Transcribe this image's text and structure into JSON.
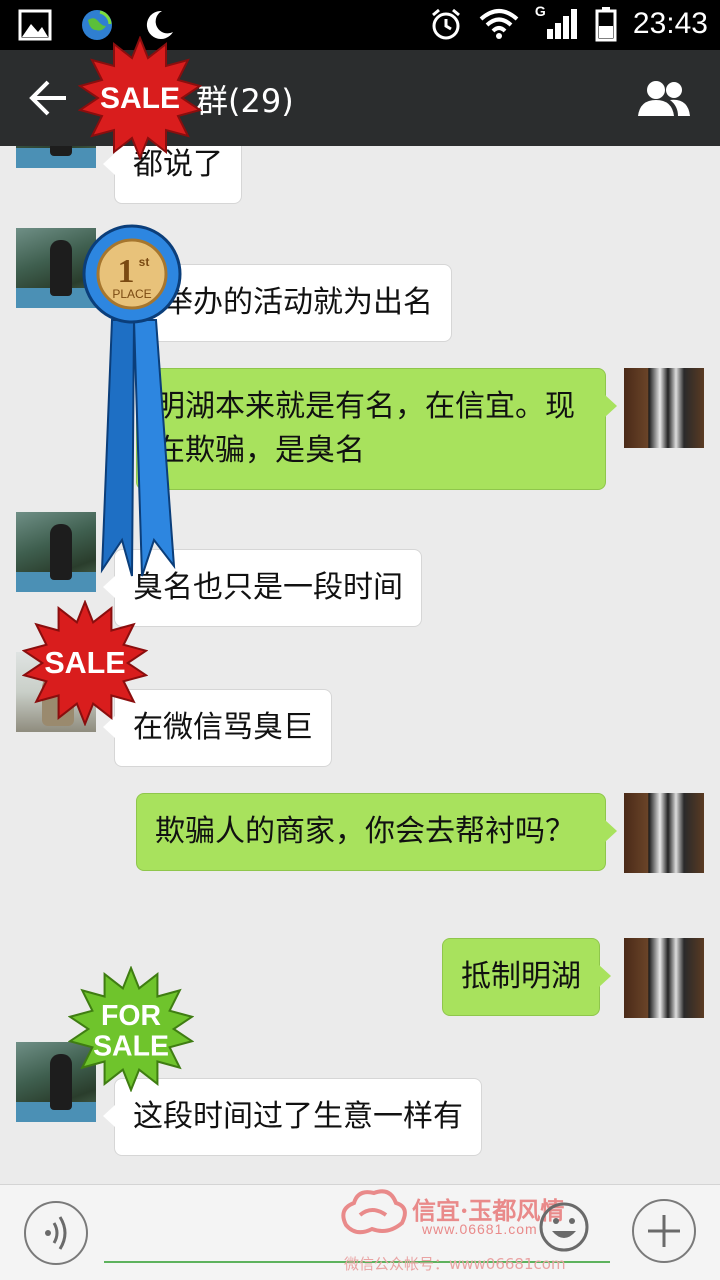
{
  "status_bar": {
    "time": "23:43",
    "network_label": "G",
    "icons": [
      "gallery-icon",
      "earth-refresh-icon",
      "moon-icon",
      "alarm-icon",
      "wifi-icon",
      "signal-icon",
      "battery-icon"
    ]
  },
  "header": {
    "title": "群(29)",
    "back_icon": "back-arrow-icon",
    "members_icon": "group-members-icon"
  },
  "messages": [
    {
      "side": "left",
      "text": "都说了"
    },
    {
      "side": "left",
      "text": "家举办的活动就为出名"
    },
    {
      "side": "right",
      "text": "明湖本来就是有名，在信宜。现在欺骗，是臭名"
    },
    {
      "side": "left",
      "text": "臭名也只是一段时间"
    },
    {
      "side": "left",
      "text": "在微信骂臭巨"
    },
    {
      "side": "right",
      "text": "欺骗人的商家，你会去帮衬吗？"
    },
    {
      "side": "right",
      "text": "抵制明湖"
    },
    {
      "side": "left",
      "text": "这段时间过了生意一样有"
    }
  ],
  "stickers": {
    "sale_top": "SALE",
    "ribbon_line1": "1",
    "ribbon_sup": "st",
    "ribbon_line2": "PLACE",
    "sale_mid": "SALE",
    "for_sale_1": "FOR",
    "for_sale_2": "SALE"
  },
  "watermark": {
    "brand": "信宜·玉都风情",
    "url": "www.06681.com",
    "account": "微信公众帐号：www06681com"
  },
  "input_bar": {
    "placeholder": "",
    "voice_icon": "voice-icon",
    "emoji_icon": "emoji-icon",
    "plus_icon": "plus-icon"
  },
  "colors": {
    "titlebar": "#2b2d2e",
    "bubble_right": "#a8e25d",
    "bubble_left": "#ffffff",
    "background": "#ebebeb"
  }
}
